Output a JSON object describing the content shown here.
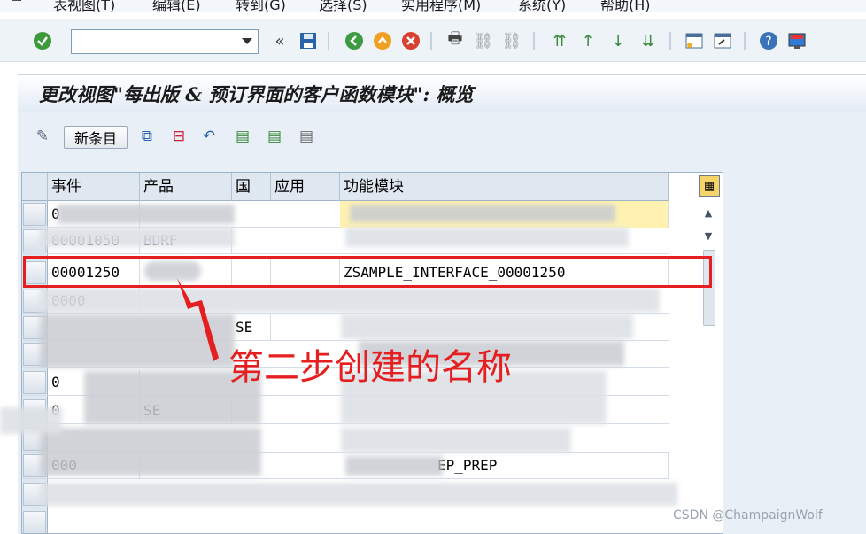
{
  "menu": {
    "items": [
      "表视图(T)",
      "编辑(E)",
      "转到(G)",
      "选择(S)",
      "实用程序(M)",
      "系统(Y)",
      "帮助(H)"
    ]
  },
  "toolbar": {
    "command_field_value": "",
    "icons": [
      "check-icon",
      "save-icon",
      "back-icon",
      "exit-icon",
      "cancel-icon",
      "print-icon",
      "find-icon",
      "find-next-icon",
      "first-page-icon",
      "prev-page-icon",
      "next-page-icon",
      "last-page-icon",
      "new-session-icon",
      "shortcut-icon",
      "help-icon",
      "layout-icon"
    ]
  },
  "title": "更改视图\"每出版 & 预订界面的客户函数模块\": 概览",
  "app_toolbar": {
    "new_entries_label": "新条目",
    "icons": [
      "display-change-icon",
      "copy-icon",
      "delete-icon",
      "undo-icon",
      "select-all-icon",
      "select-block-icon",
      "deselect-all-icon"
    ]
  },
  "table": {
    "columns": [
      "事件",
      "产品",
      "国",
      "应用",
      "功能模块"
    ],
    "rows": [
      {
        "event": "0",
        "product": "",
        "country": "",
        "app": "",
        "module": ""
      },
      {
        "event": "00001050",
        "product": "BDRF",
        "country": "",
        "app": "",
        "module": ""
      },
      {
        "event": "00001250",
        "product": "",
        "country": "",
        "app": "",
        "module": "ZSAMPLE_INTERFACE_00001250"
      },
      {
        "event": "0000",
        "product": "",
        "country": "",
        "app": "",
        "module": ""
      },
      {
        "event": "",
        "product": "",
        "country": "SE",
        "app": "",
        "module": ""
      },
      {
        "event": "",
        "product": "",
        "country": "",
        "app": "",
        "module": ""
      },
      {
        "event": "0",
        "product": "",
        "country": "",
        "app": "",
        "module": ""
      },
      {
        "event": "0",
        "product": "SE",
        "country": "",
        "app": "",
        "module": ""
      },
      {
        "event": "",
        "product": "",
        "country": "",
        "app": "",
        "module": ""
      },
      {
        "event": "000",
        "product": "",
        "country": "",
        "app": "",
        "module": "EP_PREP"
      },
      {
        "event": "",
        "product": "",
        "country": "",
        "app": "",
        "module": ""
      },
      {
        "event": "",
        "product": "",
        "country": "",
        "app": "",
        "module": ""
      }
    ]
  },
  "annotation": {
    "text": "第二步创建的名称",
    "color": "#e51f1f"
  },
  "watermark": "CSDN @ChampaignWolf"
}
